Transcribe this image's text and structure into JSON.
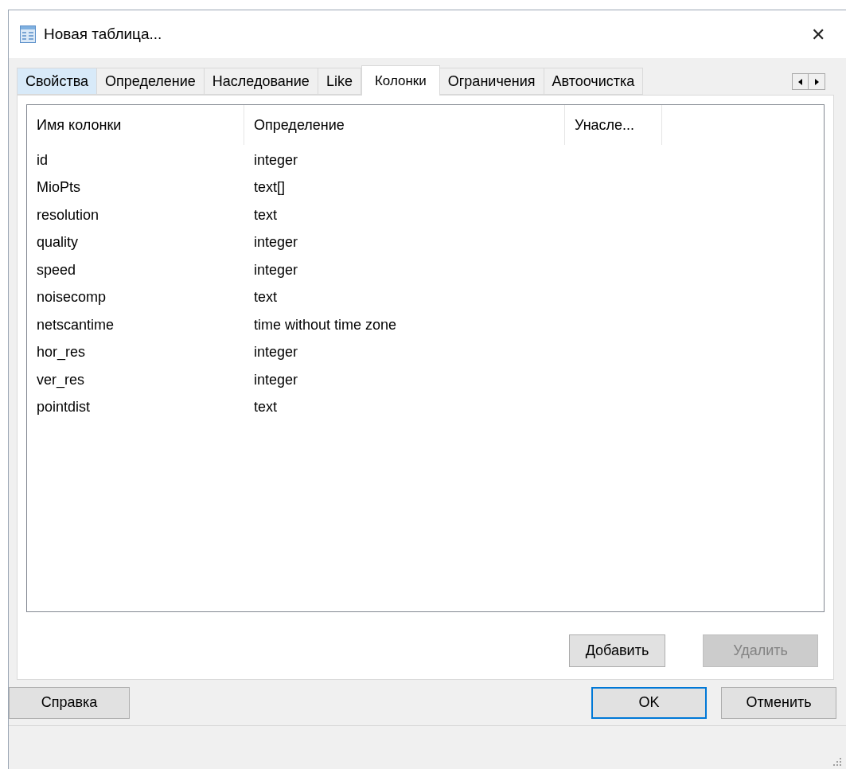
{
  "window": {
    "title": "Новая таблица...",
    "close": "✕"
  },
  "tabs": [
    {
      "label": "Свойства",
      "selected": false,
      "hovered": true
    },
    {
      "label": "Определение",
      "selected": false,
      "hovered": false
    },
    {
      "label": "Наследование",
      "selected": false,
      "hovered": false
    },
    {
      "label": "Like",
      "selected": false,
      "hovered": false
    },
    {
      "label": "Колонки",
      "selected": true,
      "hovered": false
    },
    {
      "label": "Ограничения",
      "selected": false,
      "hovered": false
    },
    {
      "label": "Автоочистка",
      "selected": false,
      "hovered": false
    }
  ],
  "table": {
    "columns": [
      "Имя колонки",
      "Определение",
      "Унасле..."
    ],
    "rows": [
      [
        "id",
        "integer"
      ],
      [
        "MioPts",
        "text[]"
      ],
      [
        "resolution",
        "text"
      ],
      [
        "quality",
        "integer"
      ],
      [
        "speed",
        "integer"
      ],
      [
        "noisecomp",
        "text"
      ],
      [
        "netscantime",
        "time without time zone"
      ],
      [
        "hor_res",
        "integer"
      ],
      [
        "ver_res",
        "integer"
      ],
      [
        "pointdist",
        "text"
      ]
    ]
  },
  "panel_buttons": [
    {
      "label": "Добавить",
      "disabled": false
    },
    {
      "label": "Удалить",
      "disabled": true
    }
  ],
  "footer": {
    "help": "Справка",
    "buttons": [
      {
        "label": "OK",
        "default": true
      },
      {
        "label": "Отменить",
        "default": false
      }
    ]
  }
}
